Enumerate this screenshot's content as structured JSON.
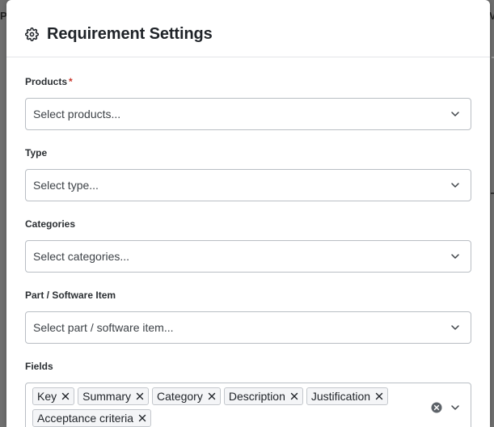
{
  "backdrop": {
    "left_fragment": "P",
    "right_fragment": "V"
  },
  "dialog": {
    "title": "Requirement Settings",
    "header_icon": "gear-icon"
  },
  "fields": {
    "products": {
      "label": "Products",
      "required_mark": "*",
      "placeholder": "Select products..."
    },
    "type": {
      "label": "Type",
      "placeholder": "Select type..."
    },
    "categories": {
      "label": "Categories",
      "placeholder": "Select categories..."
    },
    "part": {
      "label": "Part / Software Item",
      "placeholder": "Select part / software item..."
    },
    "fields_select": {
      "label": "Fields",
      "chips": [
        "Key",
        "Summary",
        "Category",
        "Description",
        "Justification",
        "Acceptance criteria"
      ]
    }
  },
  "colors": {
    "required": "#c9372c",
    "border": "#b9bec4",
    "chip_bg": "#f4f5f7"
  }
}
